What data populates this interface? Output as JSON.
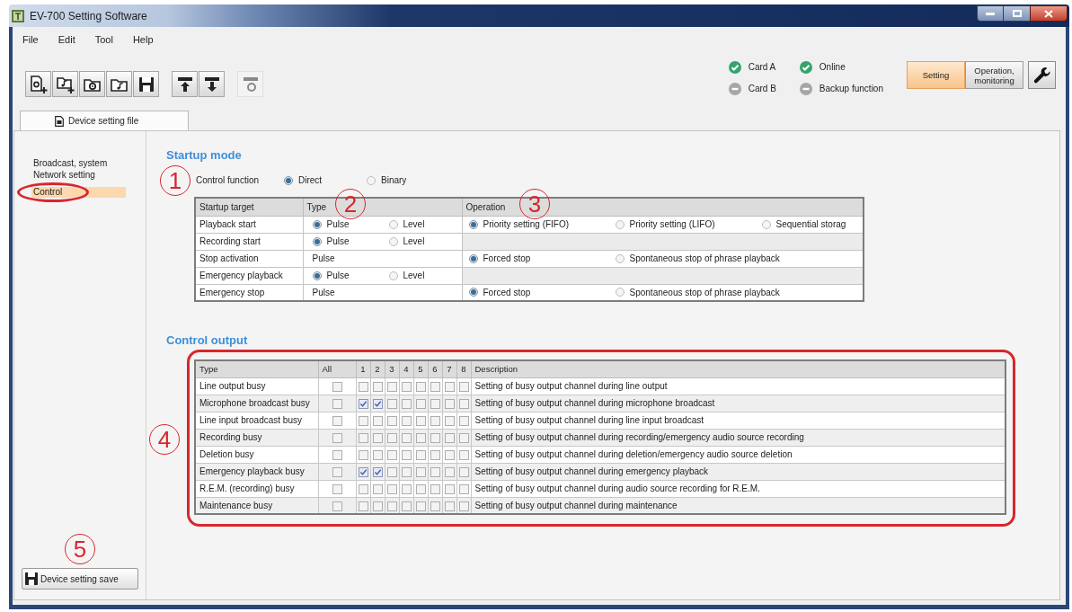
{
  "window": {
    "title": "EV-700 Setting Software"
  },
  "menu": [
    {
      "label": "File"
    },
    {
      "label": "Edit"
    },
    {
      "label": "Tool"
    },
    {
      "label": "Help"
    }
  ],
  "toolbar": [
    {
      "buttons": [
        {
          "kind": "file-add",
          "disabled": false
        },
        {
          "kind": "note-add",
          "disabled": false
        },
        {
          "kind": "disc-folder",
          "disabled": false
        },
        {
          "kind": "note-folder",
          "disabled": false
        },
        {
          "kind": "save",
          "disabled": false
        }
      ]
    },
    {
      "buttons": [
        {
          "kind": "upload",
          "disabled": false
        },
        {
          "kind": "download",
          "disabled": false
        }
      ]
    },
    {
      "buttons": [
        {
          "kind": "bar-ring",
          "disabled": true
        }
      ]
    }
  ],
  "status": [
    {
      "label": "Card A",
      "ok": true
    },
    {
      "label": "Card B",
      "ok": false
    },
    {
      "label": "Online",
      "ok": true
    },
    {
      "label": "Backup function",
      "ok": false
    }
  ],
  "modes": [
    {
      "label": "Setting",
      "selected": true
    },
    {
      "label": "Operation, monitoring",
      "selected": false
    }
  ],
  "tabs": [
    {
      "label": "Device setting file",
      "selected": true
    }
  ],
  "sidebar": {
    "items": [
      {
        "label": "Broadcast, system",
        "selected": false,
        "circled": false
      },
      {
        "label": "Network setting",
        "selected": false,
        "circled": false
      },
      {
        "label": "Control",
        "selected": true,
        "circled": true
      }
    ],
    "save_button": {
      "label": "Device setting save",
      "callout": "5"
    }
  },
  "startup_mode": {
    "heading": "Startup mode",
    "control_function": {
      "label": "Control function",
      "callout": "1",
      "options": [
        {
          "label": "Direct",
          "selected": true
        },
        {
          "label": "Binary",
          "selected": false
        }
      ]
    },
    "table": {
      "columns": [
        {
          "label": "Startup target"
        },
        {
          "label": "Type",
          "callout": "2"
        },
        {
          "label": "Operation",
          "callout": "3"
        }
      ],
      "rows": [
        {
          "target": "Playback start",
          "type": {
            "kind": "radio",
            "options": [
              {
                "label": "Pulse",
                "selected": true
              },
              {
                "label": "Level",
                "selected": false
              }
            ]
          },
          "operation": {
            "options": [
              {
                "label": "Priority setting (FIFO)",
                "selected": true
              },
              {
                "label": "Priority setting (LIFO)",
                "selected": false
              },
              {
                "label": "Sequential storag",
                "selected": false
              }
            ]
          }
        },
        {
          "target": "Recording start",
          "type": {
            "kind": "radio",
            "options": [
              {
                "label": "Pulse",
                "selected": true
              },
              {
                "label": "Level",
                "selected": false
              }
            ]
          }
        },
        {
          "target": "Stop activation",
          "type": {
            "kind": "text",
            "text": "Pulse"
          },
          "operation": {
            "options": [
              {
                "label": "Forced stop",
                "selected": true
              },
              {
                "label": "Spontaneous stop of phrase playback",
                "selected": false
              }
            ]
          }
        },
        {
          "target": "Emergency playback",
          "type": {
            "kind": "radio",
            "options": [
              {
                "label": "Pulse",
                "selected": true
              },
              {
                "label": "Level",
                "selected": false
              }
            ]
          }
        },
        {
          "target": "Emergency stop",
          "type": {
            "kind": "text",
            "text": "Pulse"
          },
          "operation": {
            "options": [
              {
                "label": "Forced stop",
                "selected": true
              },
              {
                "label": "Spontaneous stop of phrase playback",
                "selected": false
              }
            ]
          }
        }
      ]
    }
  },
  "control_output": {
    "heading": "Control output",
    "callout": "4",
    "table": {
      "columns": [
        "Type",
        "All",
        "1",
        "2",
        "3",
        "4",
        "5",
        "6",
        "7",
        "8",
        "Description"
      ],
      "rows": [
        {
          "type": "Line output busy",
          "all": {
            "checked": false
          },
          "channels": [
            {
              "checked": false
            },
            {
              "checked": false
            },
            {
              "checked": false
            },
            {
              "checked": false
            },
            {
              "checked": false
            },
            {
              "checked": false
            },
            {
              "checked": false
            },
            {
              "checked": false
            }
          ],
          "description": "Setting of busy output channel during line output"
        },
        {
          "type": "Microphone broadcast busy",
          "all": {
            "checked": false
          },
          "channels": [
            {
              "checked": true
            },
            {
              "checked": true
            },
            {
              "checked": false
            },
            {
              "checked": false
            },
            {
              "checked": false
            },
            {
              "checked": false
            },
            {
              "checked": false
            },
            {
              "checked": false
            }
          ],
          "description": "Setting of busy output channel during microphone broadcast"
        },
        {
          "type": "Line input broadcast busy",
          "all": {
            "checked": false
          },
          "channels": [
            {
              "checked": false
            },
            {
              "checked": false
            },
            {
              "checked": false
            },
            {
              "checked": false
            },
            {
              "checked": false
            },
            {
              "checked": false
            },
            {
              "checked": false
            },
            {
              "checked": false
            }
          ],
          "description": "Setting of busy output channel during line input broadcast"
        },
        {
          "type": "Recording busy",
          "all": {
            "checked": false
          },
          "channels": [
            {
              "checked": false
            },
            {
              "checked": false
            },
            {
              "checked": false
            },
            {
              "checked": false
            },
            {
              "checked": false
            },
            {
              "checked": false
            },
            {
              "checked": false
            },
            {
              "checked": false
            }
          ],
          "description": "Setting of busy output channel during recording/emergency audio source recording"
        },
        {
          "type": "Deletion busy",
          "all": {
            "checked": false
          },
          "channels": [
            {
              "checked": false
            },
            {
              "checked": false
            },
            {
              "checked": false
            },
            {
              "checked": false
            },
            {
              "checked": false
            },
            {
              "checked": false
            },
            {
              "checked": false
            },
            {
              "checked": false
            }
          ],
          "description": "Setting of busy output channel during deletion/emergency audio source deletion"
        },
        {
          "type": "Emergency playback busy",
          "all": {
            "checked": false
          },
          "channels": [
            {
              "checked": true
            },
            {
              "checked": true
            },
            {
              "checked": false
            },
            {
              "checked": false
            },
            {
              "checked": false
            },
            {
              "checked": false
            },
            {
              "checked": false
            },
            {
              "checked": false
            }
          ],
          "description": "Setting of busy output channel during emergency playback"
        },
        {
          "type": "R.E.M. (recording) busy",
          "all": {
            "checked": false
          },
          "channels": [
            {
              "checked": false
            },
            {
              "checked": false
            },
            {
              "checked": false
            },
            {
              "checked": false
            },
            {
              "checked": false
            },
            {
              "checked": false
            },
            {
              "checked": false
            },
            {
              "checked": false
            }
          ],
          "description": "Setting of busy output channel during audio source recording for R.E.M."
        },
        {
          "type": "Maintenance busy",
          "all": {
            "checked": false
          },
          "channels": [
            {
              "checked": false
            },
            {
              "checked": false
            },
            {
              "checked": false
            },
            {
              "checked": false
            },
            {
              "checked": false
            },
            {
              "checked": false
            },
            {
              "checked": false
            },
            {
              "checked": false
            }
          ],
          "description": "Setting of busy output channel during maintenance"
        }
      ]
    }
  }
}
